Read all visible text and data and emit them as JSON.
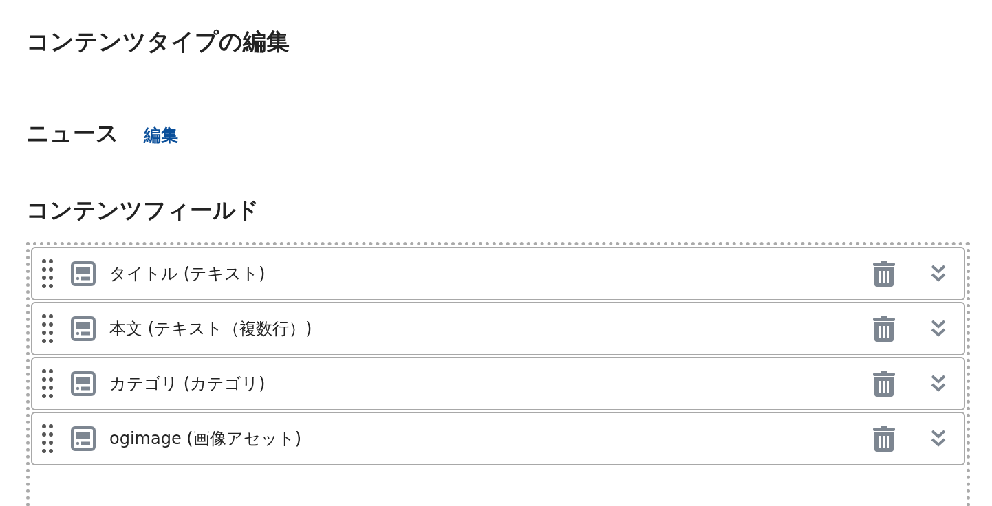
{
  "page_title": "コンテンツタイプの編集",
  "content_type": {
    "name": "ニュース",
    "edit_link": "編集"
  },
  "fields_heading": "コンテンツフィールド",
  "fields": [
    {
      "label": "タイトル (テキスト)"
    },
    {
      "label": "本文 (テキスト（複数行）)"
    },
    {
      "label": "カテゴリ (カテゴリ)"
    },
    {
      "label": "ogimage (画像アセット)"
    }
  ]
}
